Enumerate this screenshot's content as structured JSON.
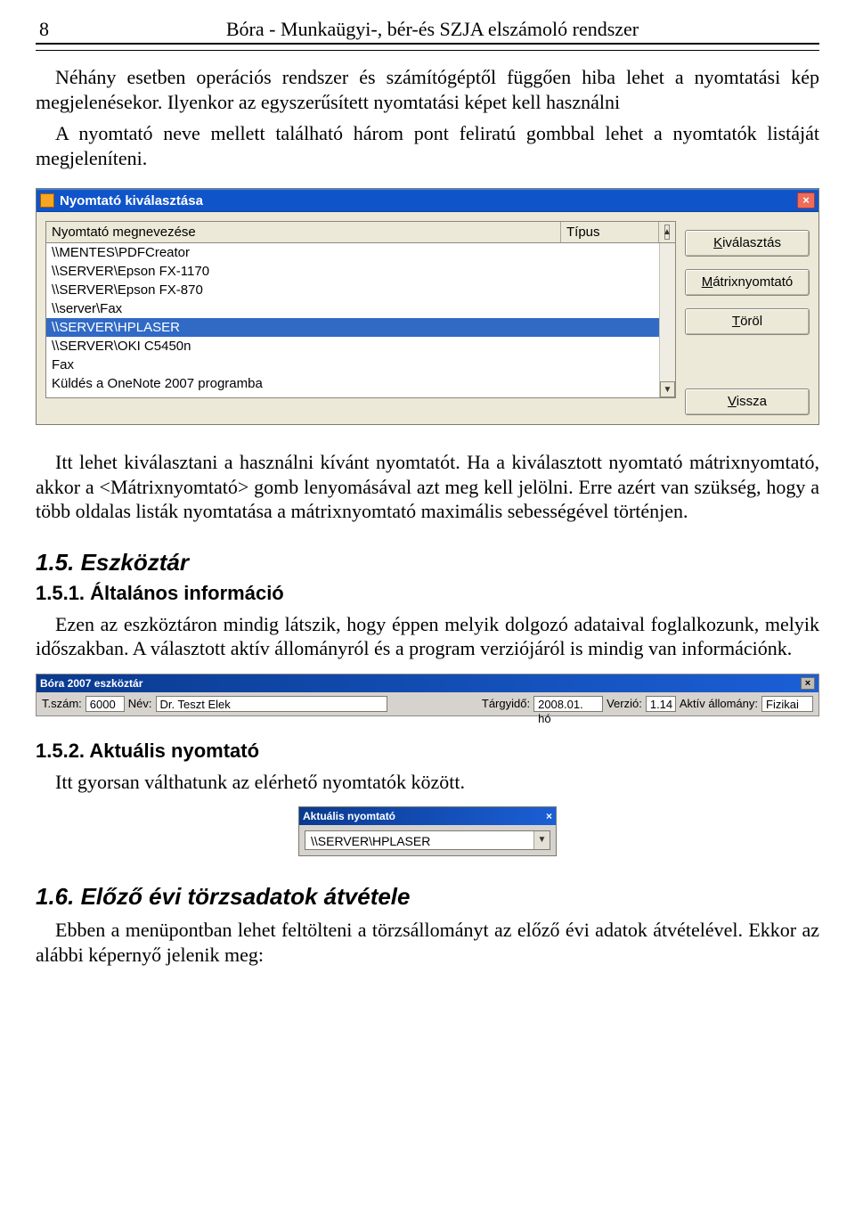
{
  "page_number": "8",
  "header_title": "Bóra - Munkaügyi-, bér-és SZJA elszámoló rendszer",
  "para1": "Néhány esetben operációs rendszer és számítógéptől függően hiba lehet a nyomtatási kép megjelenésekor. Ilyenkor az egyszerűsített nyomtatási képet kell használni",
  "para2": "A nyomtató neve mellett található három pont feliratú gombbal lehet a nyomtatók listáját megjeleníteni.",
  "printers_dialog": {
    "title": "Nyomtató kiválasztása",
    "col_name": "Nyomtató megnevezése",
    "col_type": "Típus",
    "rows": [
      "\\\\MENTES\\PDFCreator",
      "\\\\SERVER\\Epson FX-1170",
      "\\\\SERVER\\Epson FX-870",
      "\\\\server\\Fax",
      "\\\\SERVER\\HPLASER",
      "\\\\SERVER\\OKI C5450n",
      "Fax",
      "Küldés a OneNote 2007 programba"
    ],
    "selected_index": 4,
    "btn_select": {
      "pre": "K",
      "rest": "iválasztás"
    },
    "btn_matrix": {
      "pre": "M",
      "rest": "átrixnyomtató"
    },
    "btn_delete": {
      "pre": "T",
      "rest": "öröl"
    },
    "btn_back": {
      "pre": "V",
      "rest": "issza"
    }
  },
  "para3": "Itt lehet kiválasztani a használni kívánt nyomtatót. Ha a kiválasztott nyomtató mátrixnyomtató, akkor a <Mátrixnyomtató> gomb lenyomásával azt meg kell jelölni. Erre azért van szükség, hogy a több oldalas listák nyomtatása a mátrixnyomtató maximális sebességével történjen.",
  "sec15": "1.5. Eszköztár",
  "sec151": "1.5.1. Általános információ",
  "para4": "Ezen az eszköztáron mindig látszik, hogy éppen melyik dolgozó adataival foglalkozunk, melyik időszakban. A választott aktív állományról és a program verziójáról is mindig van információnk.",
  "toolbar": {
    "title": "Bóra 2007 eszköztár",
    "lbl_tszam": "T.szám:",
    "val_tszam": "6000",
    "lbl_nev": "Név:",
    "val_nev": "Dr. Teszt Elek",
    "lbl_targy": "Tárgyidő:",
    "val_targy": "2008.01. hó",
    "lbl_verzio": "Verzió:",
    "val_verzio": "1.14",
    "lbl_allomany": "Aktív állomány:",
    "val_allomany": "Fizikai"
  },
  "sec152": "1.5.2. Aktuális nyomtató",
  "para5": "Itt gyorsan válthatunk az elérhető nyomtatók között.",
  "small_dialog": {
    "title": "Aktuális nyomtató",
    "value": "\\\\SERVER\\HPLASER"
  },
  "sec16": "1.6. Előző évi törzsadatok átvétele",
  "para6": "Ebben a menüpontban lehet feltölteni a törzsállományt az előző évi adatok átvételével. Ekkor az alábbi képernyő jelenik meg:"
}
